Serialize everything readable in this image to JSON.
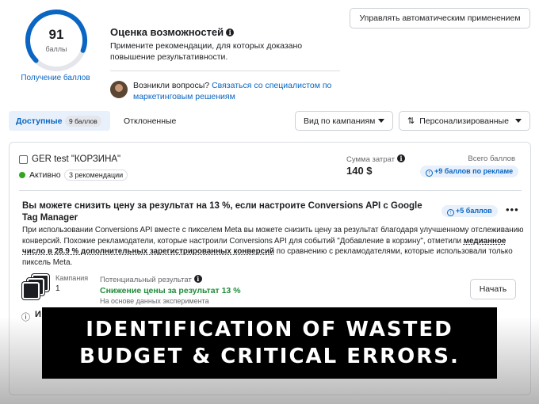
{
  "score": {
    "value": "91",
    "unit": "баллы",
    "fraction": 0.91,
    "link": "Получение баллов"
  },
  "opportunity": {
    "title": "Оценка возможностей",
    "description": "Примените рекомендации, для которых доказано повышение результативности."
  },
  "header": {
    "auto_apply_label": "Управлять автоматическим применением"
  },
  "help": {
    "question": "Возникли вопросы?",
    "link": "Связаться со специалистом по маркетинговым решениям"
  },
  "tabs": {
    "available_label": "Доступные",
    "available_badge": "9 баллов",
    "rejected_label": "Отклоненные"
  },
  "controls": {
    "view_label": "Вид по кампаниям",
    "custom_label": "Персонализированные"
  },
  "campaign": {
    "name": "GER test \"КОРЗИНА\"",
    "status": "Активно",
    "recommendations": "3 рекомендации",
    "spend_label": "Сумма затрат",
    "spend_value": "140 $",
    "total_label": "Всего баллов",
    "total_pill": "+9 баллов по рекламе"
  },
  "recommendation": {
    "title": "Вы можете снизить цену за результат на 13 %, если настроите Conversions API с Google Tag Manager",
    "pill": "+5 баллов",
    "desc_part1": "При использовании Conversions API вместе с пикселем Meta вы можете снизить цену за результат благодаря улучшенному отслеживанию конверсий. Похожие рекламодатели, которые настроили Conversions API для событий \"Добавление в корзину\", отметили ",
    "desc_bold": "медианное число в 28.9 % дополнительных зарегистрированных конверсий",
    "desc_part2": " по сравнению с рекламодателями, которые использовали только пиксель Meta.",
    "campaigns_label": "Кампания",
    "campaigns_count": "1",
    "potential_label": "Потенциальный результат",
    "potential_value": "Снижение цены за результат 13 %",
    "potential_sub": "На основе данных эксперимента",
    "start_label": "Начать",
    "partial_text": "И"
  },
  "overlay": {
    "line1": "IDENTIFICATION OF WASTED",
    "line2": "BUDGET & CRITICAL ERRORS."
  },
  "colors": {
    "accent": "#0a66c2",
    "success": "#36a420",
    "gauge_track": "#e4e6eb"
  }
}
